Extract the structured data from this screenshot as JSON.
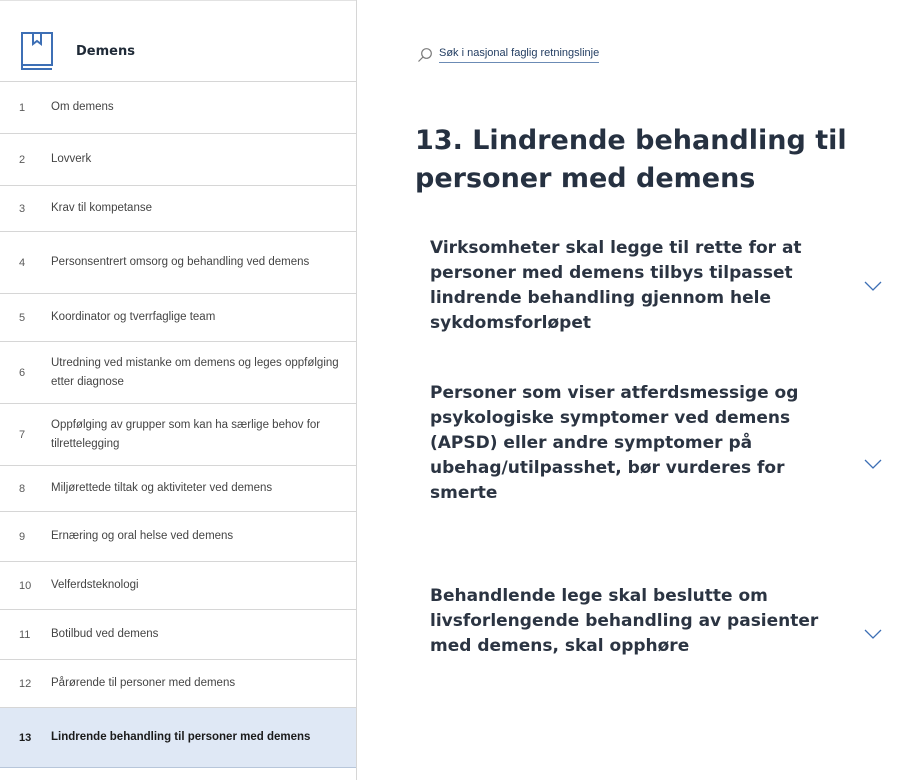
{
  "sidebar": {
    "title": "Demens",
    "items": [
      {
        "num": "1",
        "label": "Om demens"
      },
      {
        "num": "2",
        "label": "Lovverk"
      },
      {
        "num": "3",
        "label": "Krav til kompetanse"
      },
      {
        "num": "4",
        "label": "Personsentrert omsorg og behandling ved demens"
      },
      {
        "num": "5",
        "label": "Koordinator og tverrfaglige team"
      },
      {
        "num": "6",
        "label": "Utredning ved mistanke om demens og leges oppfølging etter diagnose"
      },
      {
        "num": "7",
        "label": "Oppfølging av grupper som kan ha særlige behov for tilrettelegging"
      },
      {
        "num": "8",
        "label": "Miljørettede tiltak og aktiviteter ved demens"
      },
      {
        "num": "9",
        "label": "Ernæring og oral helse ved demens"
      },
      {
        "num": "10",
        "label": "Velferdsteknologi"
      },
      {
        "num": "11",
        "label": "Botilbud ved demens"
      },
      {
        "num": "12",
        "label": "Pårørende til personer med demens"
      },
      {
        "num": "13",
        "label": "Lindrende behandling til personer med demens",
        "active": true
      }
    ]
  },
  "search": {
    "label": "Søk i nasjonal faglig retningslinje"
  },
  "main": {
    "title": "13. Lindrende behandling til personer med demens",
    "recommendations": [
      {
        "text": "Virksomheter skal legge til rette for at personer med demens tilbys tilpasset lindrende behandling gjennom hele sykdomsforløpet"
      },
      {
        "text": "Personer som viser atferdsmessige og psykologiske symptomer ved demens (APSD) eller andre symptomer på ubehag/utilpasshet, bør vurderes for smerte"
      },
      {
        "text": "Behandlende lege skal beslutte om livsforlengende behandling av pasienter med demens, skal opphøre"
      }
    ]
  },
  "colors": {
    "accent": "#3d6fb5",
    "active_bg": "#dfe8f5",
    "title": "#263141"
  }
}
